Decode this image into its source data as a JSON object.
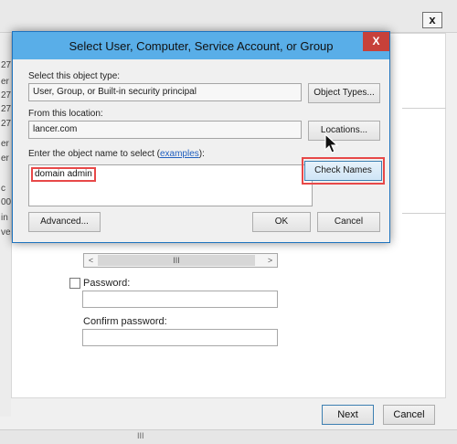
{
  "background_window": {
    "left_strip_chars": [
      "27",
      "er",
      "27",
      "27",
      "27",
      "er",
      "er",
      "c",
      "00",
      "in",
      "ve"
    ],
    "scroll_thumb_glyph": "III",
    "scroll_left_glyph": "<",
    "scroll_right_glyph": ">",
    "password_label": "Password:",
    "confirm_password_label": "Confirm password:",
    "next_label": "Next",
    "cancel_label": "Cancel",
    "close_glyph": "x",
    "bottom_grip": "III"
  },
  "dialog": {
    "title": "Select User, Computer, Service Account, or Group",
    "close_glyph": "X",
    "object_type_label": "Select this object type:",
    "object_type_value": "User, Group, or Built-in security principal",
    "object_types_button": "Object Types...",
    "location_label": "From this location:",
    "location_value": "lancer.com",
    "locations_button": "Locations...",
    "enter_name_label": "Enter the object name to select (",
    "examples_link": "examples",
    "enter_name_suffix": "):",
    "object_name_value": "domain admin",
    "check_names_button": "Check Names",
    "advanced_button": "Advanced...",
    "ok_button": "OK",
    "cancel_button": "Cancel"
  },
  "colors": {
    "title_bar": "#59aee8",
    "close_button": "#c7413a",
    "highlight": "#e74848",
    "link": "#1f5fbf"
  }
}
